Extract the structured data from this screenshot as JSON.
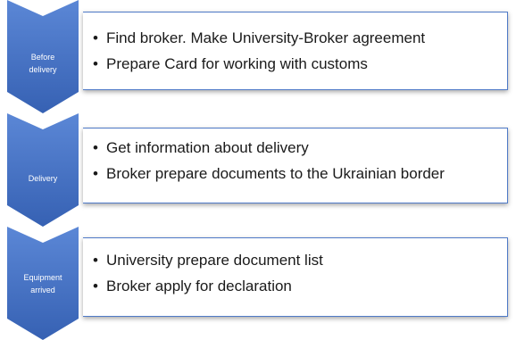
{
  "stages": [
    {
      "label": "Before\ndelivery",
      "items": [
        "Find broker. Make University-Broker agreement",
        "Prepare Card for working with customs"
      ]
    },
    {
      "label": "Delivery",
      "items": [
        "Get information about delivery",
        "Broker prepare documents to the Ukrainian  border"
      ]
    },
    {
      "label": "Equipment\narrived",
      "items": [
        "University prepare document list",
        "Broker apply for declaration"
      ]
    }
  ],
  "colors": {
    "chevron_top": "#5b87d6",
    "chevron_bottom": "#3661b3",
    "box_border": "#4f7ac7",
    "bullet_text": "#1a1a1a",
    "label_text": "#ffffff"
  },
  "icons": {
    "bullet": "•"
  }
}
